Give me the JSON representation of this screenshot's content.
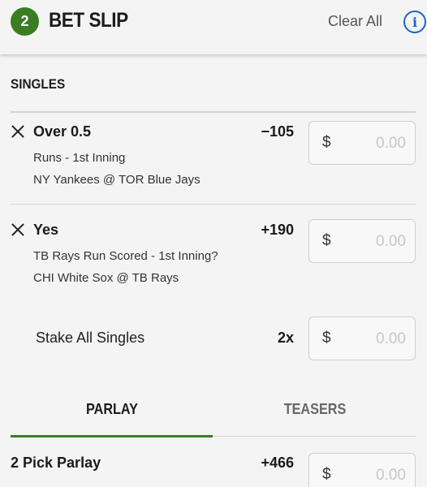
{
  "header": {
    "bet_count": "2",
    "title": "BET SLIP",
    "clear_all": "Clear All",
    "info_glyph": "i"
  },
  "singles": {
    "title": "SINGLES",
    "bets": [
      {
        "selection": "Over 0.5",
        "odds": "−105",
        "market": "Runs - 1st Inning",
        "event": "NY Yankees @ TOR Blue Jays",
        "stake_currency": "$",
        "stake_placeholder": "0.00"
      },
      {
        "selection": "Yes",
        "odds": "+190",
        "market": "TB Rays Run Scored - 1st Inning?",
        "event": "CHI White Sox @ TB Rays",
        "stake_currency": "$",
        "stake_placeholder": "0.00"
      }
    ],
    "stake_all": {
      "label": "Stake All Singles",
      "multiplier": "2x",
      "currency": "$",
      "placeholder": "0.00"
    }
  },
  "tabs": [
    {
      "label": "PARLAY",
      "active": true
    },
    {
      "label": "TEASERS",
      "active": false
    }
  ],
  "parlay": {
    "name": "2 Pick Parlay",
    "odds": "+466",
    "currency": "$",
    "placeholder": "0.00"
  },
  "colors": {
    "accent_green": "#3a7d23",
    "info_blue": "#1d64c8"
  },
  "icons": {
    "remove": "close-icon",
    "info": "info-icon"
  }
}
